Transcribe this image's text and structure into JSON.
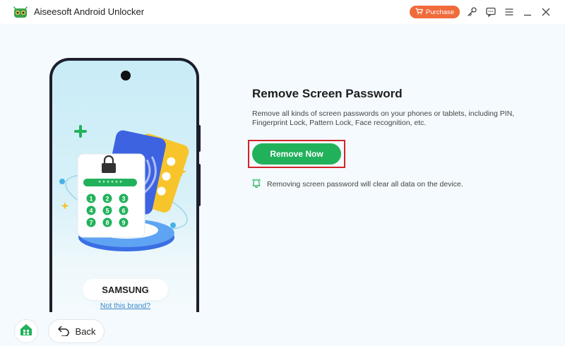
{
  "window": {
    "title": "Aiseesoft Android Unlocker",
    "purchase_label": "Purchase"
  },
  "device": {
    "brand": "SAMSUNG",
    "not_brand_link": "Not this brand?"
  },
  "nav": {
    "back_label": "Back"
  },
  "content": {
    "title": "Remove Screen Password",
    "description": "Remove all kinds of screen passwords on your phones or tablets, including PIN, Fingerprint Lock, Pattern Lock, Face recognition, etc.",
    "remove_button": "Remove Now",
    "warning": "Removing screen password will clear all data on the device."
  },
  "illustration": {
    "pin_mask": "* * * * * *",
    "keypad": [
      "1",
      "2",
      "3",
      "4",
      "5",
      "6",
      "7",
      "8",
      "9"
    ]
  },
  "colors": {
    "accent_green": "#22b15b",
    "purchase_orange": "#f06a3a",
    "highlight_red": "#d0242b",
    "link_blue": "#3a86c8"
  },
  "icons": {
    "logo": "android-unlocker-logo",
    "purchase": "cart-icon",
    "key": "key-icon",
    "feedback": "chat-icon",
    "menu": "menu-icon",
    "minimize": "minimize-icon",
    "close": "close-icon",
    "home": "home-icon",
    "back": "back-arrow-icon",
    "warning": "bell-icon"
  }
}
